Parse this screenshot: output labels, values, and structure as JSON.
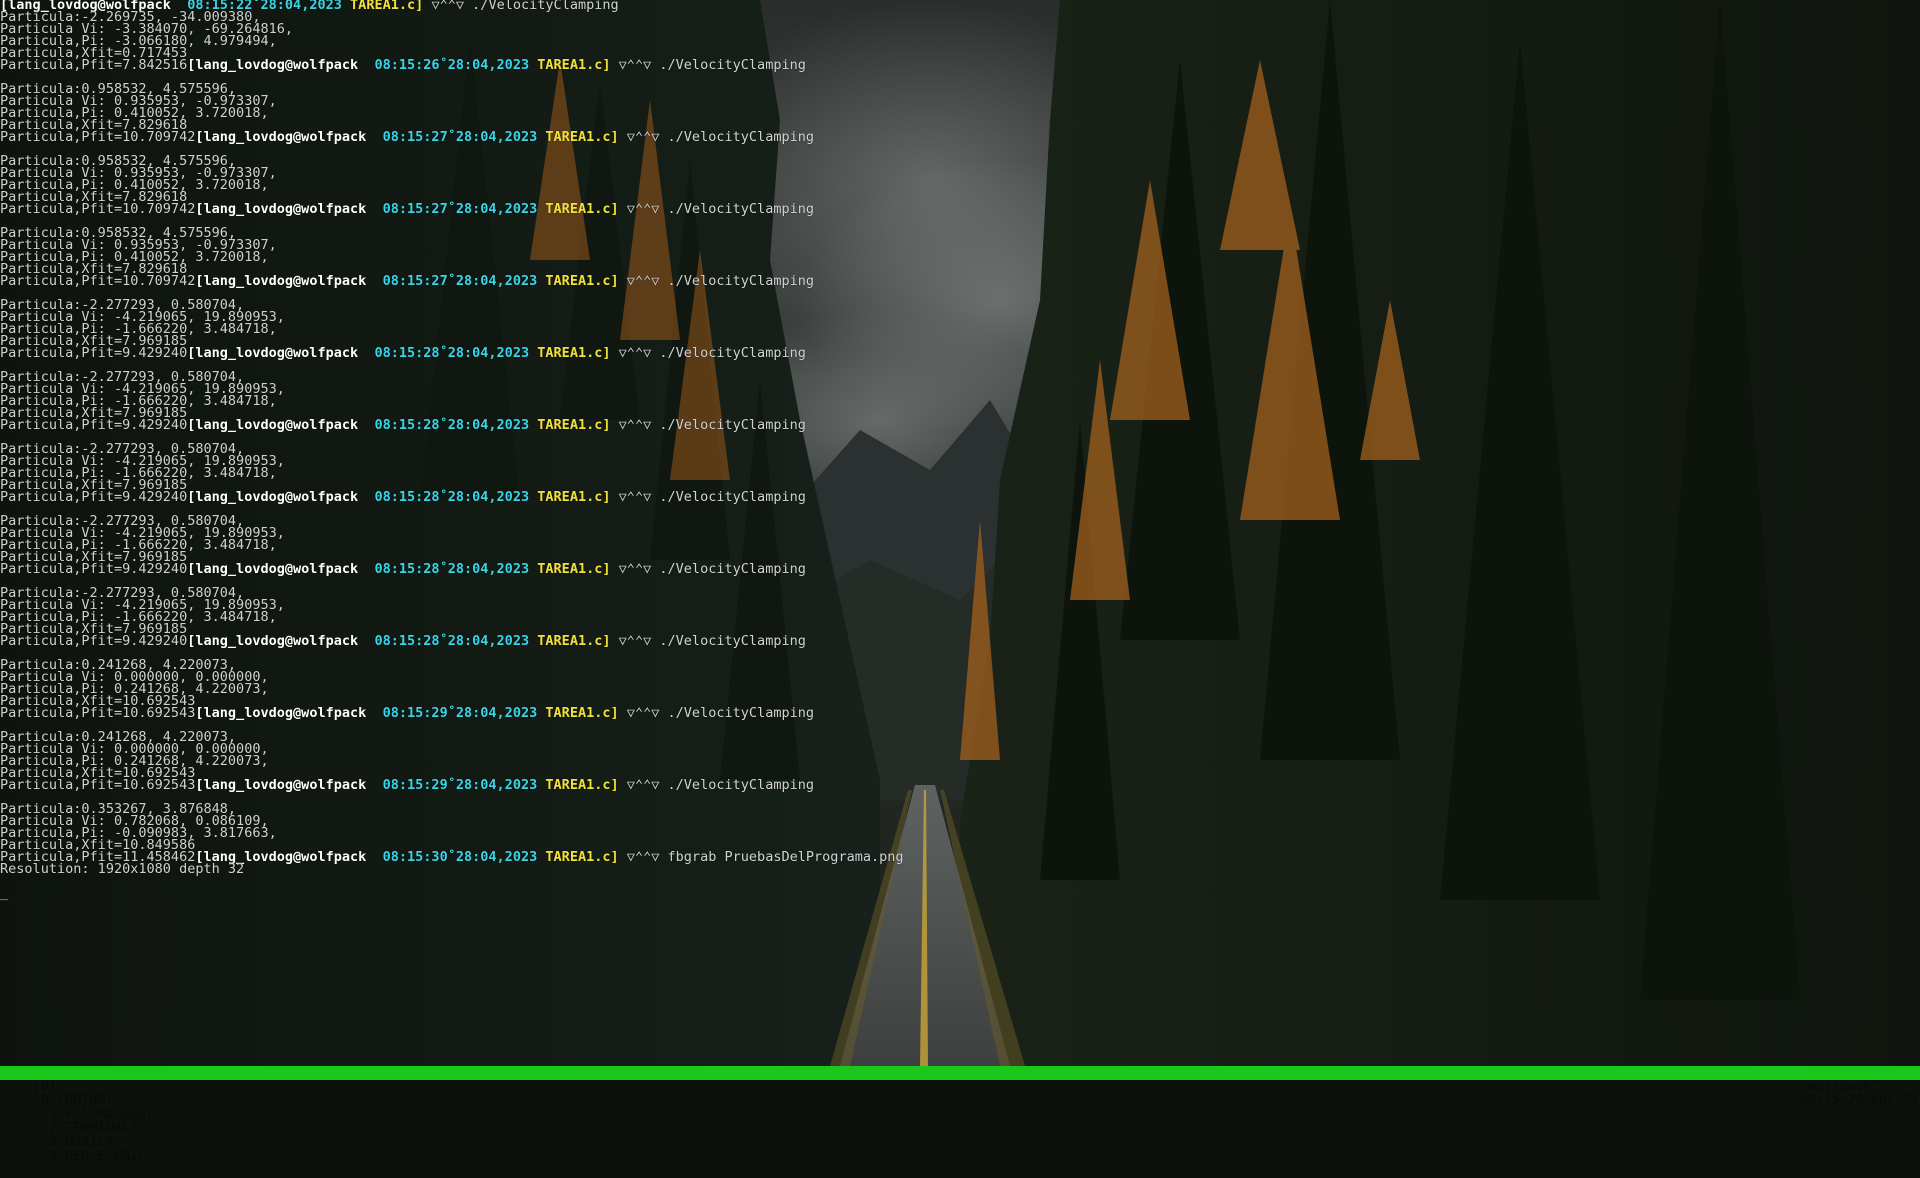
{
  "terminal": {
    "lines": [
      {
        "type": "prompt",
        "pre": "",
        "user": "[lang_lovdog@wolfpack",
        "time": "08:15:22˚28:04,2023",
        "file": "TAREA1.c]",
        "sym": "▽⌃⌃▽",
        "cmd": "./VelocityClamping"
      },
      {
        "type": "text",
        "text": "Particula:-2.269735, -34.009380,"
      },
      {
        "type": "text",
        "text": "Particula Vi: -3.384070, -69.264816,"
      },
      {
        "type": "text",
        "text": "Particula,Pi: -3.066180, 4.979494,"
      },
      {
        "type": "text",
        "text": "Particula,Xfit=0.717453"
      },
      {
        "type": "prompt",
        "pre": "Particula,Pfit=7.842516",
        "user": "[lang_lovdog@wolfpack",
        "time": "08:15:26˚28:04,2023",
        "file": "TAREA1.c]",
        "sym": "▽⌃⌃▽",
        "cmd": "./VelocityClamping"
      },
      {
        "type": "gap"
      },
      {
        "type": "text",
        "text": "Particula:0.958532, 4.575596,"
      },
      {
        "type": "text",
        "text": "Particula Vi: 0.935953, -0.973307,"
      },
      {
        "type": "text",
        "text": "Particula,Pi: 0.410052, 3.720018,"
      },
      {
        "type": "text",
        "text": "Particula,Xfit=7.829618"
      },
      {
        "type": "prompt",
        "pre": "Particula,Pfit=10.709742",
        "user": "[lang_lovdog@wolfpack",
        "time": "08:15:27˚28:04,2023",
        "file": "TAREA1.c]",
        "sym": "▽⌃⌃▽",
        "cmd": "./VelocityClamping"
      },
      {
        "type": "gap"
      },
      {
        "type": "text",
        "text": "Particula:0.958532, 4.575596,"
      },
      {
        "type": "text",
        "text": "Particula Vi: 0.935953, -0.973307,"
      },
      {
        "type": "text",
        "text": "Particula,Pi: 0.410052, 3.720018,"
      },
      {
        "type": "text",
        "text": "Particula,Xfit=7.829618"
      },
      {
        "type": "prompt",
        "pre": "Particula,Pfit=10.709742",
        "user": "[lang_lovdog@wolfpack",
        "time": "08:15:27˚28:04,2023",
        "file": "TAREA1.c]",
        "sym": "▽⌃⌃▽",
        "cmd": "./VelocityClamping"
      },
      {
        "type": "gap"
      },
      {
        "type": "text",
        "text": "Particula:0.958532, 4.575596,"
      },
      {
        "type": "text",
        "text": "Particula Vi: 0.935953, -0.973307,"
      },
      {
        "type": "text",
        "text": "Particula,Pi: 0.410052, 3.720018,"
      },
      {
        "type": "text",
        "text": "Particula,Xfit=7.829618"
      },
      {
        "type": "prompt",
        "pre": "Particula,Pfit=10.709742",
        "user": "[lang_lovdog@wolfpack",
        "time": "08:15:27˚28:04,2023",
        "file": "TAREA1.c]",
        "sym": "▽⌃⌃▽",
        "cmd": "./VelocityClamping"
      },
      {
        "type": "gap"
      },
      {
        "type": "text",
        "text": "Particula:-2.277293, 0.580704,"
      },
      {
        "type": "text",
        "text": "Particula Vi: -4.219065, 19.890953,"
      },
      {
        "type": "text",
        "text": "Particula,Pi: -1.666220, 3.484718,"
      },
      {
        "type": "text",
        "text": "Particula,Xfit=7.969185"
      },
      {
        "type": "prompt",
        "pre": "Particula,Pfit=9.429240",
        "user": "[lang_lovdog@wolfpack",
        "time": "08:15:28˚28:04,2023",
        "file": "TAREA1.c]",
        "sym": "▽⌃⌃▽",
        "cmd": "./VelocityClamping"
      },
      {
        "type": "gap"
      },
      {
        "type": "text",
        "text": "Particula:-2.277293, 0.580704,"
      },
      {
        "type": "text",
        "text": "Particula Vi: -4.219065, 19.890953,"
      },
      {
        "type": "text",
        "text": "Particula,Pi: -1.666220, 3.484718,"
      },
      {
        "type": "text",
        "text": "Particula,Xfit=7.969185"
      },
      {
        "type": "prompt",
        "pre": "Particula,Pfit=9.429240",
        "user": "[lang_lovdog@wolfpack",
        "time": "08:15:28˚28:04,2023",
        "file": "TAREA1.c]",
        "sym": "▽⌃⌃▽",
        "cmd": "./VelocityClamping"
      },
      {
        "type": "gap"
      },
      {
        "type": "text",
        "text": "Particula:-2.277293, 0.580704,"
      },
      {
        "type": "text",
        "text": "Particula Vi: -4.219065, 19.890953,"
      },
      {
        "type": "text",
        "text": "Particula,Pi: -1.666220, 3.484718,"
      },
      {
        "type": "text",
        "text": "Particula,Xfit=7.969185"
      },
      {
        "type": "prompt",
        "pre": "Particula,Pfit=9.429240",
        "user": "[lang_lovdog@wolfpack",
        "time": "08:15:28˚28:04,2023",
        "file": "TAREA1.c]",
        "sym": "▽⌃⌃▽",
        "cmd": "./VelocityClamping"
      },
      {
        "type": "gap"
      },
      {
        "type": "text",
        "text": "Particula:-2.277293, 0.580704,"
      },
      {
        "type": "text",
        "text": "Particula Vi: -4.219065, 19.890953,"
      },
      {
        "type": "text",
        "text": "Particula,Pi: -1.666220, 3.484718,"
      },
      {
        "type": "text",
        "text": "Particula,Xfit=7.969185"
      },
      {
        "type": "prompt",
        "pre": "Particula,Pfit=9.429240",
        "user": "[lang_lovdog@wolfpack",
        "time": "08:15:28˚28:04,2023",
        "file": "TAREA1.c]",
        "sym": "▽⌃⌃▽",
        "cmd": "./VelocityClamping"
      },
      {
        "type": "gap"
      },
      {
        "type": "text",
        "text": "Particula:-2.277293, 0.580704,"
      },
      {
        "type": "text",
        "text": "Particula Vi: -4.219065, 19.890953,"
      },
      {
        "type": "text",
        "text": "Particula,Pi: -1.666220, 3.484718,"
      },
      {
        "type": "text",
        "text": "Particula,Xfit=7.969185"
      },
      {
        "type": "prompt",
        "pre": "Particula,Pfit=9.429240",
        "user": "[lang_lovdog@wolfpack",
        "time": "08:15:28˚28:04,2023",
        "file": "TAREA1.c]",
        "sym": "▽⌃⌃▽",
        "cmd": "./VelocityClamping"
      },
      {
        "type": "gap"
      },
      {
        "type": "text",
        "text": "Particula:0.241268, 4.220073,"
      },
      {
        "type": "text",
        "text": "Particula Vi: 0.000000, 0.000000,"
      },
      {
        "type": "text",
        "text": "Particula,Pi: 0.241268, 4.220073,"
      },
      {
        "type": "text",
        "text": "Particula,Xfit=10.692543"
      },
      {
        "type": "prompt",
        "pre": "Particula,Pfit=10.692543",
        "user": "[lang_lovdog@wolfpack",
        "time": "08:15:29˚28:04,2023",
        "file": "TAREA1.c]",
        "sym": "▽⌃⌃▽",
        "cmd": "./VelocityClamping"
      },
      {
        "type": "gap"
      },
      {
        "type": "text",
        "text": "Particula:0.241268, 4.220073,"
      },
      {
        "type": "text",
        "text": "Particula Vi: 0.000000, 0.000000,"
      },
      {
        "type": "text",
        "text": "Particula,Pi: 0.241268, 4.220073,"
      },
      {
        "type": "text",
        "text": "Particula,Xfit=10.692543"
      },
      {
        "type": "prompt",
        "pre": "Particula,Pfit=10.692543",
        "user": "[lang_lovdog@wolfpack",
        "time": "08:15:29˚28:04,2023",
        "file": "TAREA1.c]",
        "sym": "▽⌃⌃▽",
        "cmd": "./VelocityClamping"
      },
      {
        "type": "gap"
      },
      {
        "type": "text",
        "text": "Particula:0.353267, 3.876848,"
      },
      {
        "type": "text",
        "text": "Particula Vi: 0.782068, 0.086109,"
      },
      {
        "type": "text",
        "text": "Particula,Pi: -0.090983, 3.817663,"
      },
      {
        "type": "text",
        "text": "Particula,Xfit=10.849586"
      },
      {
        "type": "prompt",
        "pre": "Particula,Pfit=11.458462",
        "user": "[lang_lovdog@wolfpack",
        "time": "08:15:30˚28:04,2023",
        "file": "TAREA1.c]",
        "sym": "▽⌃⌃▽",
        "cmd": "fbgrab PruebasDelPrograma.png"
      },
      {
        "type": "text",
        "text": "Resolution: 1920x1080 depth 32"
      },
      {
        "type": "gap"
      },
      {
        "type": "cursor",
        "text": "_"
      }
    ]
  },
  "statusbar": {
    "session": "[0]",
    "windows": [
      {
        "label": "0:CODING!-"
      },
      {
        "label": "1:FileManager"
      },
      {
        "label": "2:TERMINAL*"
      },
      {
        "label": "3:MúSICA"
      },
      {
        "label": "4:DER E-MAIL"
      }
    ],
    "host": "\"wolfpack\"",
    "clock": "08:15 28-Apr-23"
  },
  "colors": {
    "status_bg": "#19c81a",
    "timestamp": "#39d5e8",
    "filename": "#f0e23a",
    "user": "#ffffff",
    "text": "#d2d2d2"
  }
}
